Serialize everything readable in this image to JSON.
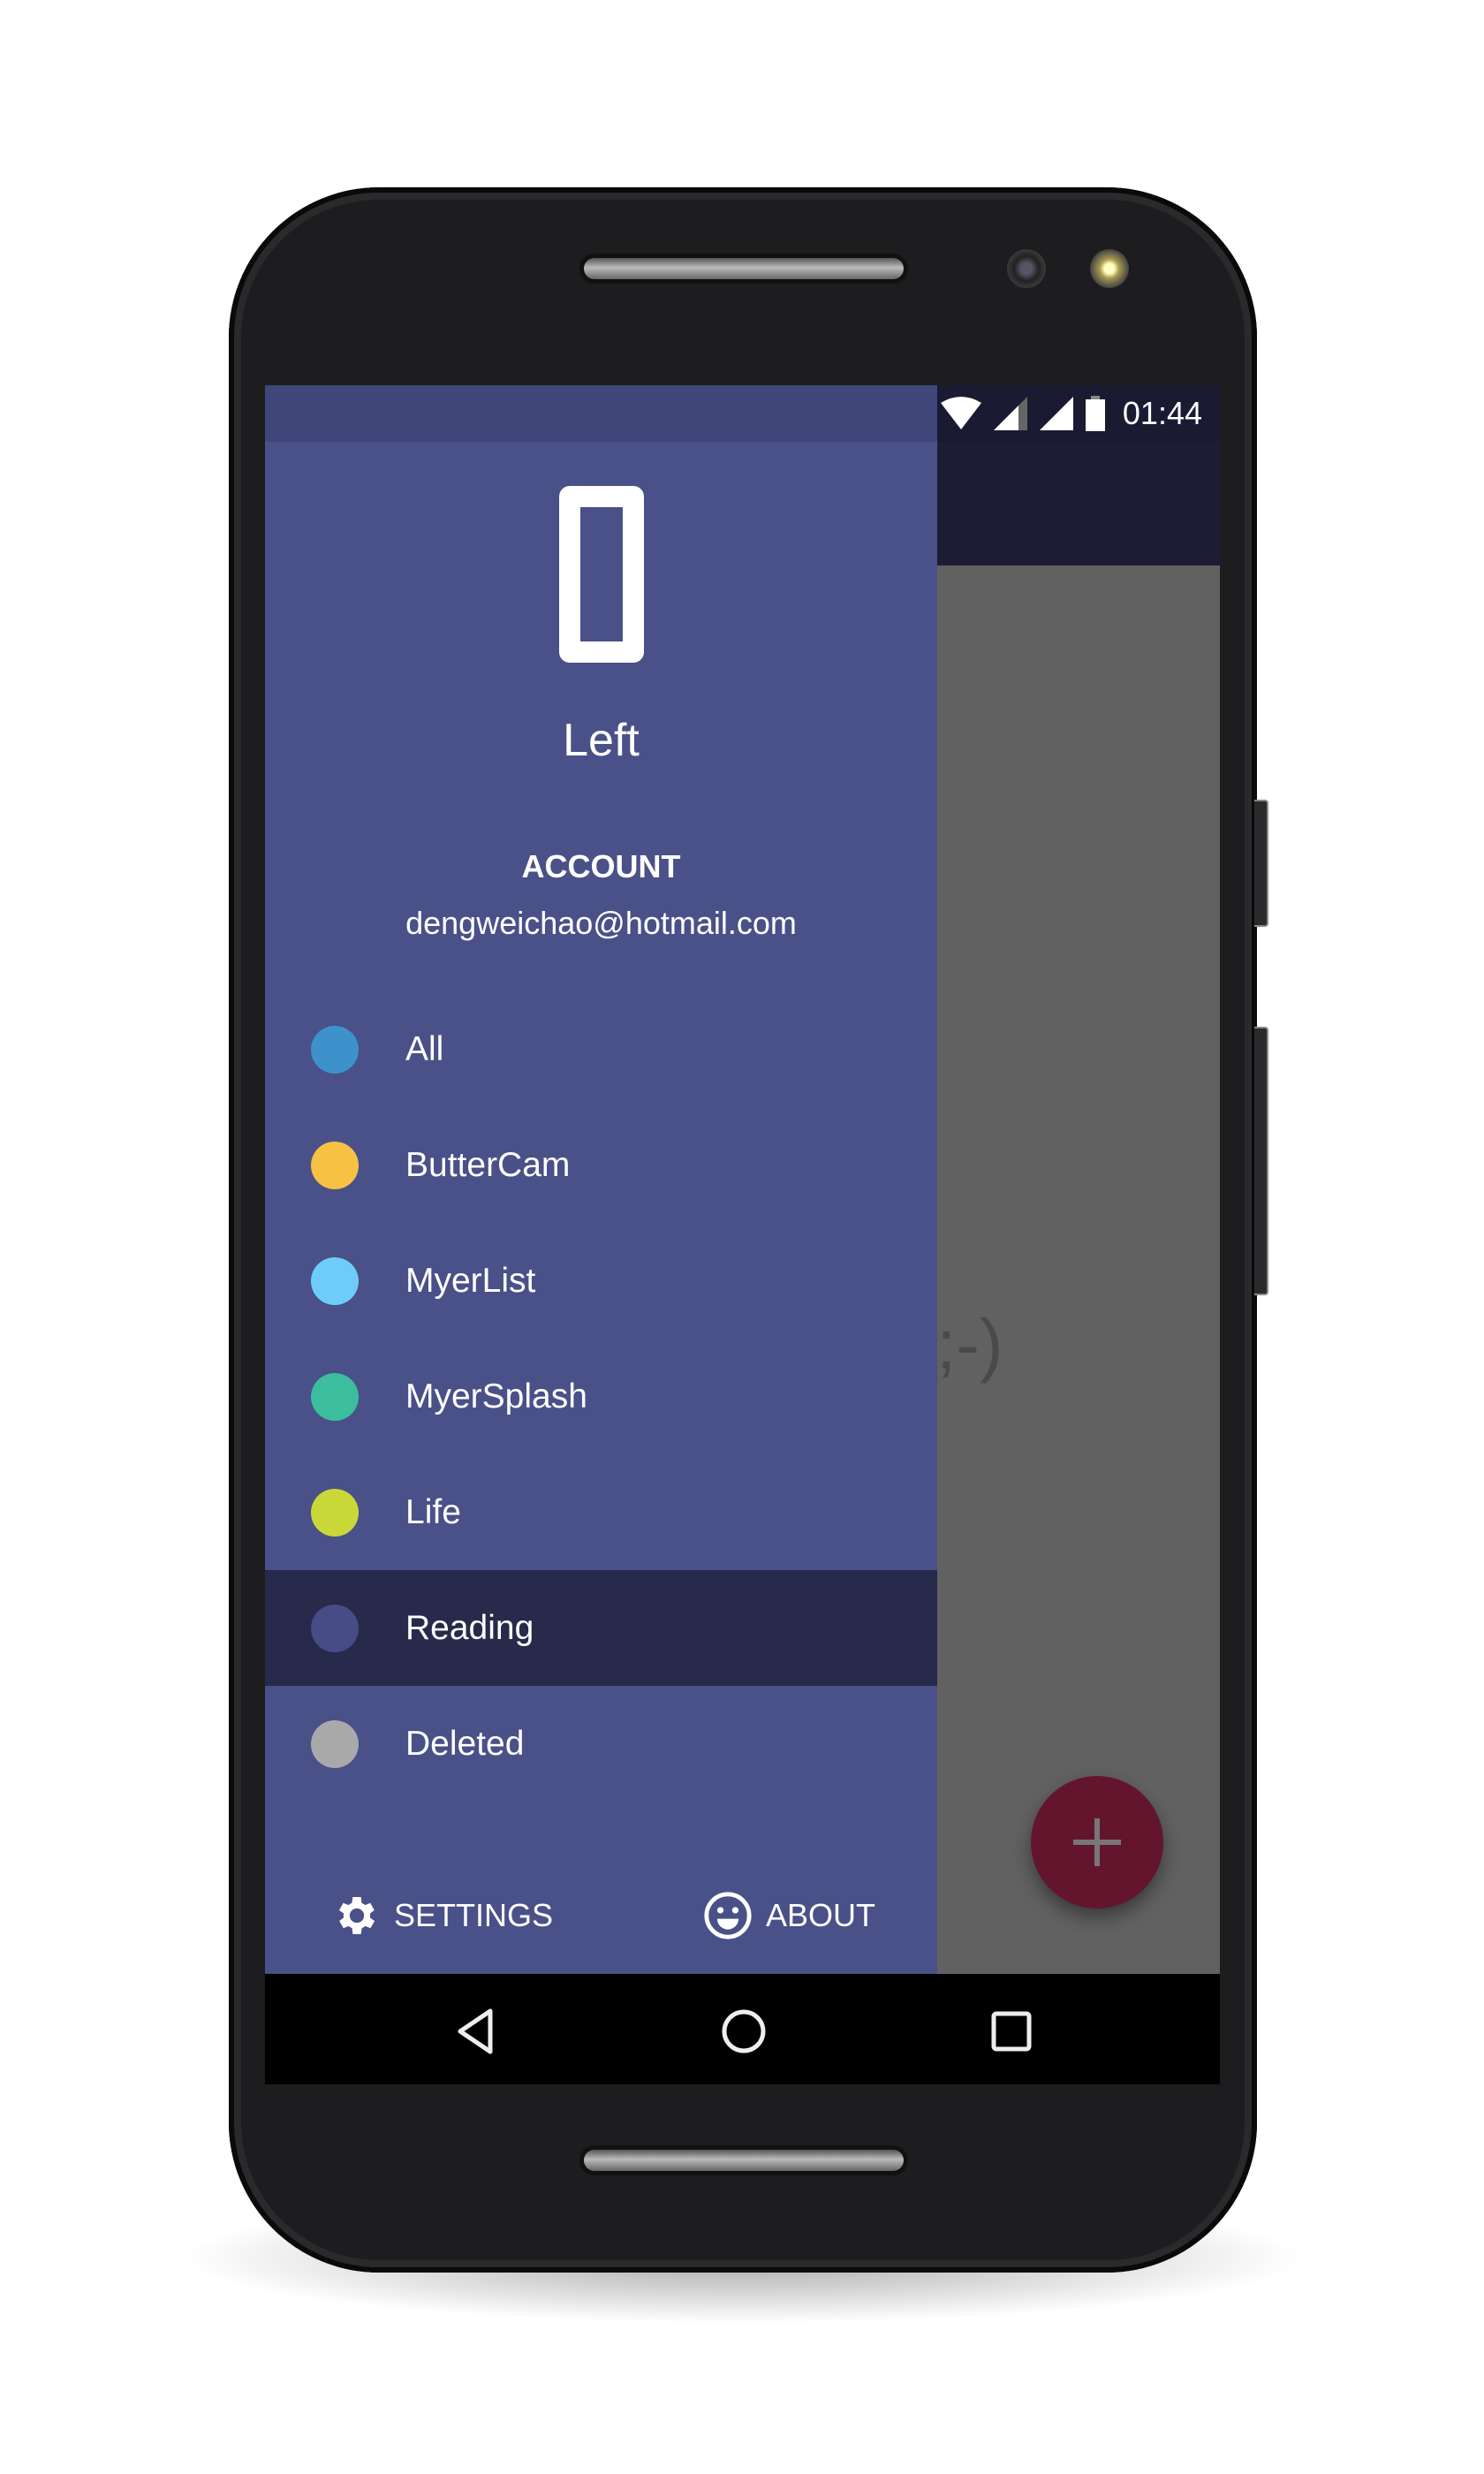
{
  "status_bar": {
    "time": "01:44"
  },
  "content": {
    "empty_text": ";-)"
  },
  "drawer": {
    "title": "Left",
    "account_label": "ACCOUNT",
    "email": "dengweichao@hotmail.com",
    "items": [
      {
        "label": "All",
        "color": "#3e92cc",
        "selected": false
      },
      {
        "label": "ButterCam",
        "color": "#f7c243",
        "selected": false
      },
      {
        "label": "MyerList",
        "color": "#6dcdf8",
        "selected": false
      },
      {
        "label": "MyerSplash",
        "color": "#3bbd9e",
        "selected": false
      },
      {
        "label": "Life",
        "color": "#c9d739",
        "selected": false
      },
      {
        "label": "Reading",
        "color": "#474c86",
        "selected": true
      },
      {
        "label": "Deleted",
        "color": "#a9a9a9",
        "selected": false
      }
    ],
    "footer": {
      "settings_label": "SETTINGS",
      "about_label": "ABOUT"
    }
  },
  "colors": {
    "drawer": "#4a5088",
    "selected_row": "#272a4a",
    "toolbar": "#1c1d35",
    "fab": "#63152d",
    "scrim": "#616161"
  }
}
